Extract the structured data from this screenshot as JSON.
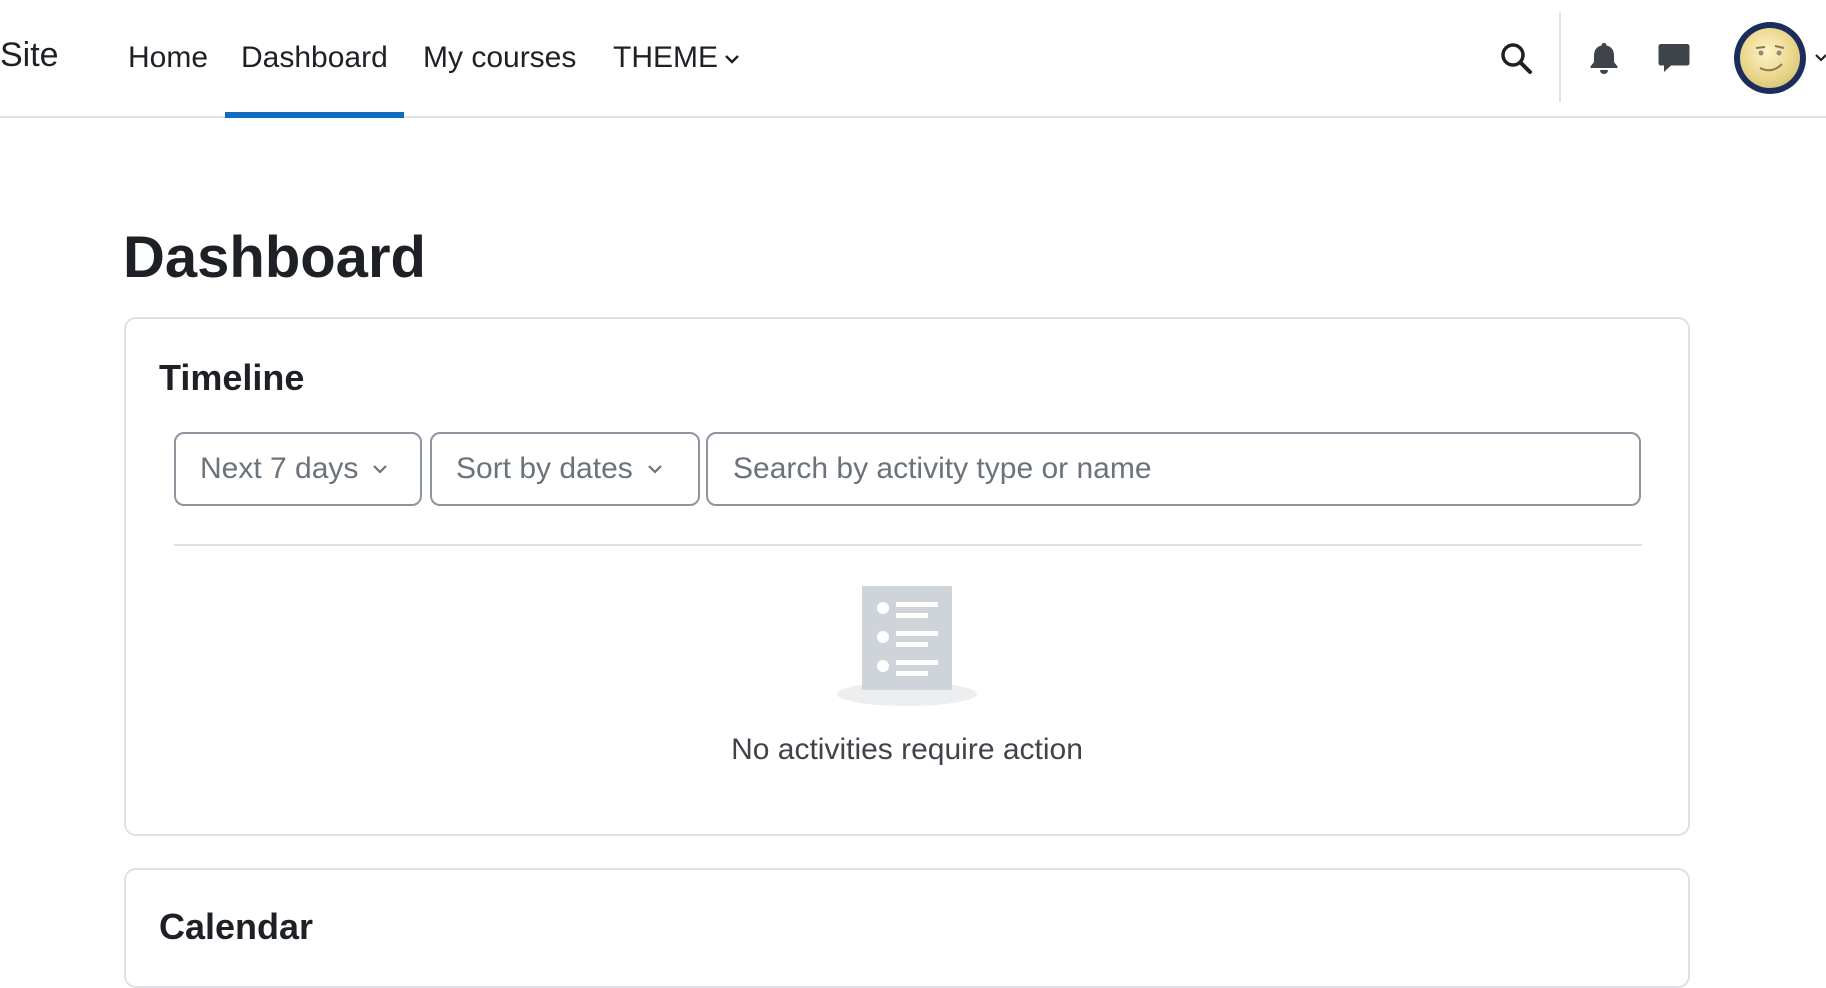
{
  "navbar": {
    "brand": "Site",
    "items": [
      {
        "label": "Home"
      },
      {
        "label": "Dashboard",
        "active": true
      },
      {
        "label": "My courses"
      },
      {
        "label": "THEME"
      }
    ],
    "icons": [
      "search-icon",
      "bell-icon",
      "chat-icon",
      "user-avatar",
      "chevron-down-icon"
    ]
  },
  "page": {
    "title": "Dashboard"
  },
  "timeline": {
    "title": "Timeline",
    "range_select": "Next 7 days",
    "sort_select": "Sort by dates",
    "search_placeholder": "Search by activity type or name",
    "search_value": "",
    "empty_message": "No activities require action"
  },
  "calendar": {
    "title": "Calendar"
  },
  "colors": {
    "accent": "#0f6cbf",
    "border": "#dee2e6",
    "text": "#1d2125",
    "muted": "#6a737b",
    "illustration": "#ced4da"
  }
}
